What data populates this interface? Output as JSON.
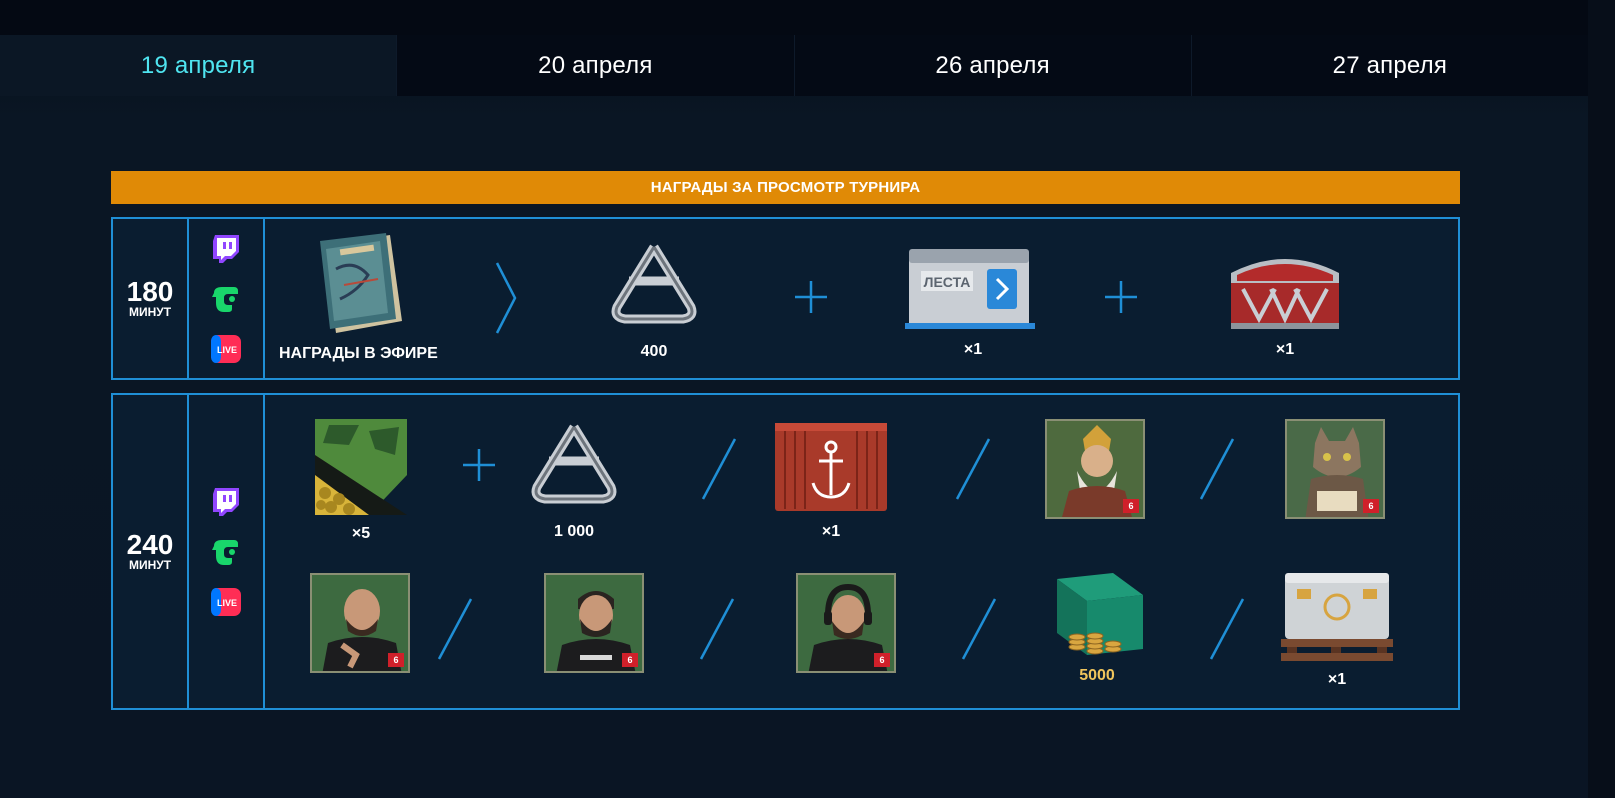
{
  "tabs": [
    {
      "label": "19 апреля",
      "active": true
    },
    {
      "label": "20 апреля",
      "active": false
    },
    {
      "label": "26 апреля",
      "active": false
    },
    {
      "label": "27 апреля",
      "active": false
    }
  ],
  "banner": {
    "title": "НАГРАДЫ ЗА ПРОСМОТР ТУРНИРА"
  },
  "tier1": {
    "minutes": "180",
    "minutes_label": "МИНУТ",
    "platforms": [
      "twitch-icon",
      "trovo-icon",
      "vk-live-icon"
    ],
    "rewards": [
      {
        "icon": "broadcast-rewards-book-icon",
        "label": "НАГРАДЫ В ЭФИРЕ"
      },
      {
        "icon": "steel-chain-icon",
        "label": "400"
      },
      {
        "icon": "lesta-container-icon",
        "label": "×1"
      },
      {
        "icon": "red-chest-icon",
        "label": "×1"
      }
    ]
  },
  "tier2": {
    "minutes": "240",
    "minutes_label": "МИНУТ",
    "platforms": [
      "twitch-icon",
      "trovo-icon",
      "vk-live-icon"
    ],
    "row1": [
      {
        "icon": "camouflage-icon",
        "label": "×5"
      },
      {
        "icon": "steel-chain-icon",
        "label": "1 000"
      },
      {
        "icon": "anchor-container-icon",
        "label": "×1"
      },
      {
        "icon": "commander-portrait-knight-icon",
        "level": "6"
      },
      {
        "icon": "commander-portrait-cat-icon",
        "level": "6"
      }
    ],
    "row2": [
      {
        "icon": "commander-portrait-bald-icon",
        "level": "6"
      },
      {
        "icon": "commander-portrait-beard-icon",
        "level": "6"
      },
      {
        "icon": "commander-portrait-headphones-icon",
        "level": "6"
      },
      {
        "icon": "gold-coins-icon",
        "label": "5000"
      },
      {
        "icon": "white-container-icon",
        "label": "×1"
      }
    ]
  },
  "colors": {
    "accent_tab": "#4fe4f0",
    "banner": "#e08a06",
    "border": "#1f8fd6",
    "gold_text": "#f0c55c"
  }
}
